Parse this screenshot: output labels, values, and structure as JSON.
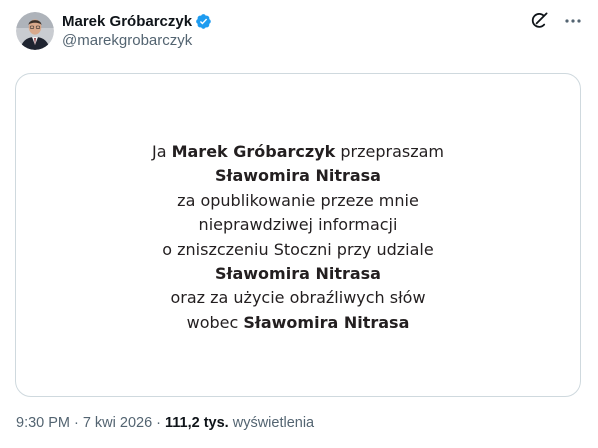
{
  "author": {
    "display_name": "Marek Gróbarczyk",
    "handle": "@marekgrobarczyk",
    "verified": true
  },
  "media": {
    "lines": [
      [
        "Ja ",
        {
          "b": "Marek Gróbarczyk"
        },
        " przepraszam"
      ],
      [
        {
          "b": "Sławomira Nitrasa"
        }
      ],
      [
        "za opublikowanie przeze mnie"
      ],
      [
        "nieprawdziwej informacji"
      ],
      [
        "o zniszczeniu Stoczni przy udziale"
      ],
      [
        {
          "b": "Sławomira Nitrasa"
        }
      ],
      [
        "oraz za użycie obraźliwych słów"
      ],
      [
        "wobec ",
        {
          "b": "Sławomira Nitrasa"
        }
      ]
    ]
  },
  "meta": {
    "time": "9:30 PM",
    "date": "7 kwi 2026",
    "separator": "·",
    "views_count": "111,2 tys.",
    "views_label": "wyświetlenia"
  },
  "icons": {
    "grok": "grok-icon",
    "more": "more-icon",
    "verified": "verified-badge-icon"
  },
  "colors": {
    "verified_blue": "#1d9bf0",
    "secondary_text": "#536471",
    "border": "#cfd9de"
  }
}
